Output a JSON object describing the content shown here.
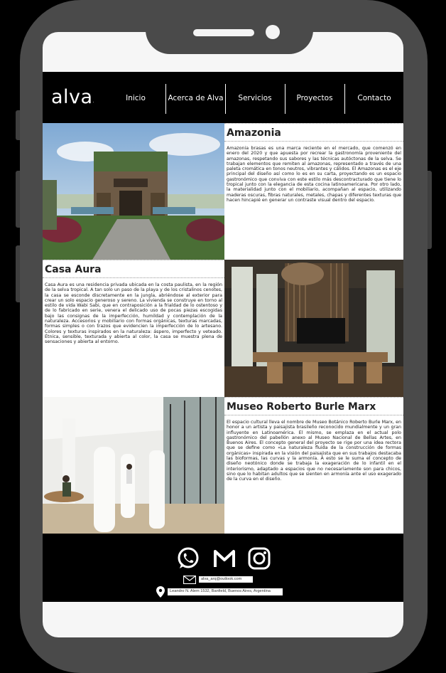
{
  "brand": {
    "logo_text": "alva"
  },
  "nav": {
    "items": [
      {
        "label": "Inicio"
      },
      {
        "label": "Acerca de Alva"
      },
      {
        "label": "Servicios"
      },
      {
        "label": "Proyectos"
      },
      {
        "label": "Contacto"
      }
    ]
  },
  "projects": [
    {
      "title": "Amazonia",
      "body": " Amazonia brasas es una marca reciente en el mercado, que comenzó en enero del 2020 y que apuesta por recrear la gastronomía proveniente del amazonas, respetando sus sabores y las técnicas autóctonas de la selva. Se trabajan elementos que remiten al amazonas, representado a través de una paleta cromática en tonos neutros, vibrantes y cálidos. El Amazonas es el eje principal del diseño así como lo es en su carta, proyectando es un espacio gastronómico que conviva con este estilo más descontracturado que tiene lo tropical junto con la elegancia de esta cocina latinoamericana. Por otro lado, la materialidad junto con el mobiliario, acompañan al espacio, utilizando maderas oscuras, fibras naturales, metales, chapas y diferentes texturas que hacen hincapié en generar un contraste visual dentro del espacio."
    },
    {
      "title": "Casa Aura",
      "body": "Casa Aura es una residencia privada ubicada en la costa paulista, en la región de la selva tropical. A tan solo un paso de la playa y de los cristalinos cenotes, la casa se esconde discretamente en la jungla, abriéndose al exterior para crear un solo espacio generoso y sereno. La vivienda se construye en torno al estilo de vida Wabi Sabi, que en contraposición a la frialdad de lo ostentoso y de lo fabricado en serie, venera el delicado uso de pocas piezas escogidas bajo las consignas de la imperfección, humildad y contemplación de la naturaleza. Accesorios y mobiliario con formas orgánicas, texturas marcadas, formas simples o con trazos que evidencien la imperfección de lo artesano. Colores y texturas inspirados en la naturaleza: áspero, imperfecto y veteado. Étnica, sensible, texturada y abierta al color, la casa se muestra plena de sensaciones y abierta al entorno."
    },
    {
      "title": "Museo Roberto Burle Marx",
      "body": "El espacio cultural lleva el nombre de Museo Botánico Roberto Burle Marx, en honor a un artista y paisajista brasileño reconocido mundialmente y un gran influyente en Latinoamérica. El mismo, se emplaza en el actual polo gastronómico del pabellón anexo al Museo Nacional de Bellas Artes, en Buenos Aires. El concepto general del proyecto se rige por una idea rectora que se define como «La naturaleza fluida de la construcción de formas orgánicas» inspirada en la visión del paisajista que en sus trabajos destacaba las bioformas, las curvas y la armonía. A esto se le suma el concepto de diseño neotónico donde se trabaja la exageración de lo infantil en el interiorismo, adaptado a espacios que no necesariamente son para chicos, sino que lo habitan adultos que se sienten en armonía ante el uso exagerado de la curva en el diseño."
    }
  ],
  "footer": {
    "social_icons": [
      "whatsapp-icon",
      "gmail-icon",
      "instagram-icon"
    ],
    "email": "alva_arq@outlook.com",
    "address": "Leandro N. Alem 1532, Banfield, Buenos Aires, Argentina"
  }
}
